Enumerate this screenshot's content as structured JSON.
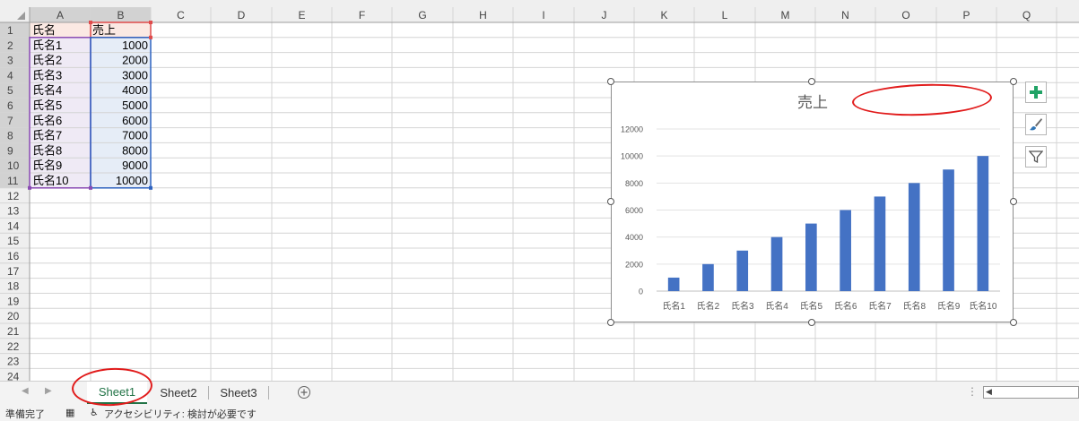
{
  "columns": [
    "A",
    "B",
    "C",
    "D",
    "E",
    "F",
    "G",
    "H",
    "I",
    "J",
    "K",
    "L",
    "M",
    "N",
    "O",
    "P",
    "Q"
  ],
  "rows": [
    "1",
    "2",
    "3",
    "4",
    "5",
    "6",
    "7",
    "8",
    "9",
    "10",
    "11",
    "12",
    "13",
    "14",
    "15",
    "16",
    "17",
    "18",
    "19",
    "20",
    "21",
    "22",
    "23",
    "24"
  ],
  "cells": {
    "header_name": "氏名",
    "header_sales": "売上",
    "names": [
      "氏名1",
      "氏名2",
      "氏名3",
      "氏名4",
      "氏名5",
      "氏名6",
      "氏名7",
      "氏名8",
      "氏名9",
      "氏名10"
    ],
    "sales": [
      "1000",
      "2000",
      "3000",
      "4000",
      "5000",
      "6000",
      "7000",
      "8000",
      "9000",
      "10000"
    ]
  },
  "chart_data": {
    "type": "bar",
    "title": "売上",
    "categories": [
      "氏名1",
      "氏名2",
      "氏名3",
      "氏名4",
      "氏名5",
      "氏名6",
      "氏名7",
      "氏名8",
      "氏名9",
      "氏名10"
    ],
    "values": [
      1000,
      2000,
      3000,
      4000,
      5000,
      6000,
      7000,
      8000,
      9000,
      10000
    ],
    "yticks": [
      "0",
      "2000",
      "4000",
      "6000",
      "8000",
      "10000",
      "12000"
    ],
    "ylim": [
      0,
      12000
    ],
    "grid": true,
    "legend": "none",
    "bar_color": "#4472c4"
  },
  "chart_buttons": [
    {
      "name": "chart-elements-button",
      "icon": "plus-icon"
    },
    {
      "name": "chart-styles-button",
      "icon": "brush-icon"
    },
    {
      "name": "chart-filters-button",
      "icon": "filter-icon"
    }
  ],
  "tabs": {
    "sheets": [
      "Sheet1",
      "Sheet2",
      "Sheet3"
    ],
    "active": "Sheet1",
    "add_icon": "plus-circle-icon"
  },
  "status": {
    "ready": "準備完了",
    "accessibility": "アクセシビリティ: 検討が必要です"
  },
  "colors": {
    "accent_green": "#217346",
    "annotation_red": "#e11b1b"
  }
}
